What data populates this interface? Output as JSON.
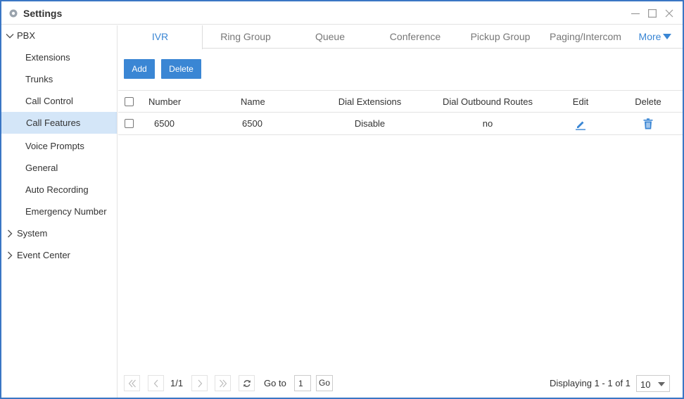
{
  "window": {
    "title": "Settings"
  },
  "sidebar": {
    "pbx": {
      "label": "PBX"
    },
    "items": [
      {
        "label": "Extensions"
      },
      {
        "label": "Trunks"
      },
      {
        "label": "Call Control"
      },
      {
        "label": "Call Features"
      },
      {
        "label": "Voice Prompts"
      },
      {
        "label": "General"
      },
      {
        "label": "Auto Recording"
      },
      {
        "label": "Emergency Number"
      }
    ],
    "system": {
      "label": "System"
    },
    "event_center": {
      "label": "Event Center"
    }
  },
  "tabs": [
    {
      "label": "IVR"
    },
    {
      "label": "Ring Group"
    },
    {
      "label": "Queue"
    },
    {
      "label": "Conference"
    },
    {
      "label": "Pickup Group"
    },
    {
      "label": "Paging/Intercom"
    },
    {
      "label": "More"
    }
  ],
  "toolbar": {
    "add_label": "Add",
    "delete_label": "Delete"
  },
  "table": {
    "columns": [
      "Number",
      "Name",
      "Dial Extensions",
      "Dial Outbound Routes",
      "Edit",
      "Delete"
    ],
    "rows": [
      {
        "number": "6500",
        "name": "6500",
        "dial_extensions": "Disable",
        "dial_outbound_routes": "no"
      }
    ]
  },
  "pagination": {
    "page_info": "1/1",
    "goto_label": "Go to",
    "goto_value": "1",
    "go_label": "Go",
    "displaying": "Displaying 1 - 1 of 1",
    "page_size": "10"
  },
  "colors": {
    "accent": "#3a86d4",
    "active_nav": "#d4e6f8",
    "window_border": "#3a76c4"
  }
}
